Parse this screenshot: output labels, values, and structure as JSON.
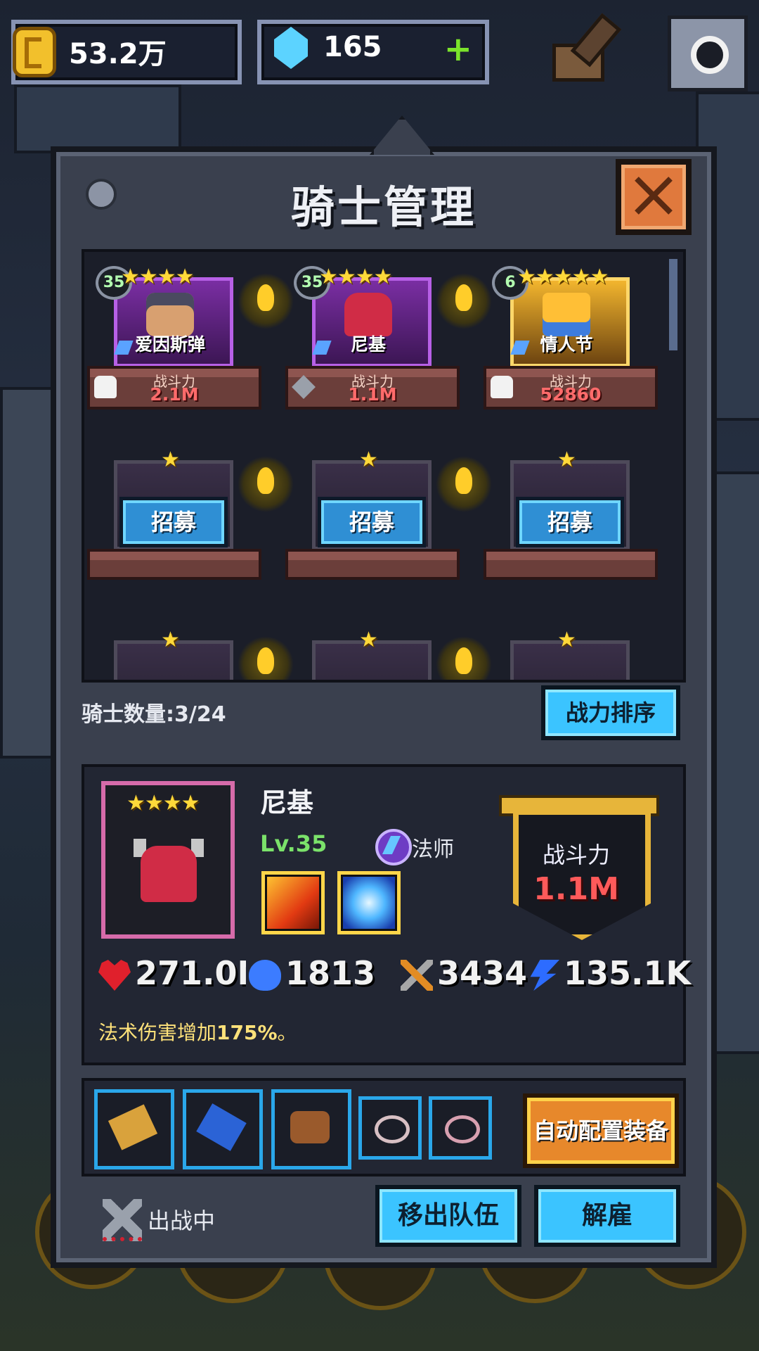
{
  "topbar": {
    "gold": "53.2万",
    "gems": "165",
    "gems_plus": "+"
  },
  "dialog": {
    "title": "骑士管理"
  },
  "roster": {
    "heroes": [
      {
        "level": "35",
        "stars": "★★★★",
        "name": "爱因斯弹",
        "status": "rest",
        "power_label": "战斗力",
        "power": "2.1M"
      },
      {
        "level": "35",
        "stars": "★★★★",
        "name": "尼基",
        "status": "fight",
        "power_label": "战斗力",
        "power": "1.1M"
      },
      {
        "level": "6",
        "stars": "★★★★★",
        "name": "情人节",
        "status": "rest",
        "power_label": "战斗力",
        "power": "52860"
      }
    ],
    "empty_slots": [
      {
        "stars": "★",
        "button": "招募"
      },
      {
        "stars": "★",
        "button": "招募"
      },
      {
        "stars": "★",
        "button": "招募"
      }
    ],
    "partial_row_stars": [
      "★",
      "★",
      "★"
    ]
  },
  "count_label": "骑士数量:3/24",
  "sort_button": "战力排序",
  "selected": {
    "stars": "★★★★",
    "name": "尼基",
    "level": "Lv.35",
    "class": "法师",
    "power_label": "战斗力",
    "power": "1.1M",
    "stats": {
      "hp": "271.0M",
      "mana": "1813",
      "attack": "3434",
      "speed": "135.1K"
    },
    "passive": "法术伤害增加",
    "passive_value": "175%",
    "passive_end": "。"
  },
  "equipment": {
    "auto_button": "自动配置装备"
  },
  "footer": {
    "status": "出战中",
    "remove_button": "移出队伍",
    "dismiss_button": "解雇"
  },
  "colors": {
    "accent_blue": "#3bc4ff",
    "accent_gold": "#e7b53a",
    "power_red": "#ff5a5a"
  }
}
